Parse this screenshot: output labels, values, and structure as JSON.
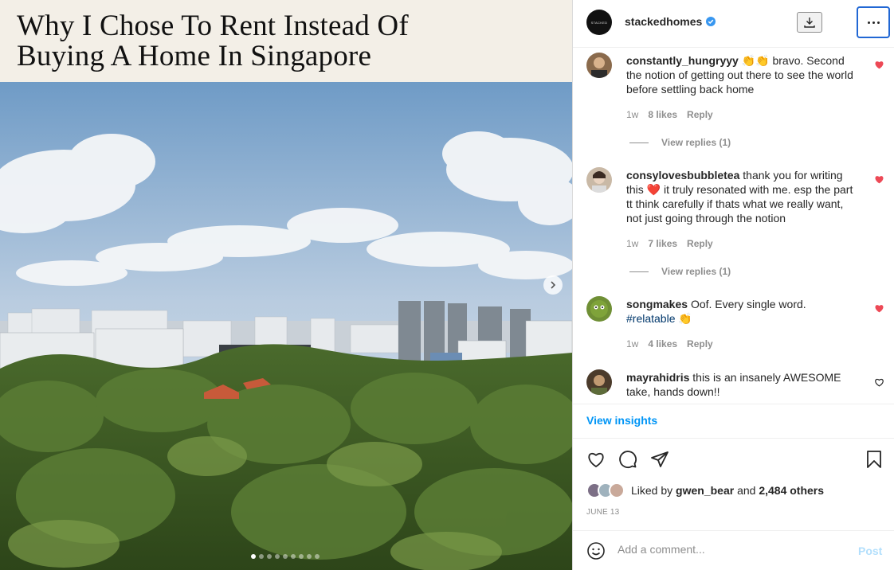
{
  "post": {
    "title_line1": "Why I Chose To Rent Instead Of",
    "title_line2": "Buying A Home In Singapore",
    "carousel": {
      "total": 9,
      "active": 1
    }
  },
  "header": {
    "avatar_text": "STACKED",
    "username": "stackedhomes"
  },
  "comments": [
    {
      "user": "constantly_hungryyy",
      "text": "👏👏 bravo. Second the notion of getting out there to see the world before settling back home",
      "time": "1w",
      "likes": "8 likes",
      "reply": "Reply",
      "view_replies": "View replies (1)",
      "liked": true
    },
    {
      "user": "consylovesbubbletea",
      "text": "thank you for writing this ❤️ it truly resonated with me. esp the part tt think carefully if thats what we really want, not just going through the notion",
      "time": "1w",
      "likes": "7 likes",
      "reply": "Reply",
      "view_replies": "View replies (1)",
      "liked": true
    },
    {
      "user": "songmakes",
      "text": "Oof. Every single word.",
      "tag": "#relatable",
      "tag_emoji": "👏",
      "time": "1w",
      "likes": "4 likes",
      "reply": "Reply",
      "liked": true
    },
    {
      "user": "mayrahidris",
      "text": "this is an insanely AWESOME take, hands down!!",
      "liked": false
    }
  ],
  "insights_label": "View insights",
  "likes_line": {
    "prefix": "Liked by",
    "user": "gwen_bear",
    "and": "and",
    "others": "2,484 others"
  },
  "date": "JUNE 13",
  "add_comment": {
    "placeholder": "Add a comment...",
    "post_label": "Post"
  },
  "colors": {
    "accent": "#0095f6",
    "heart_red": "#ed4956",
    "verified": "#3897f0",
    "focus_ring": "#2167d4"
  }
}
